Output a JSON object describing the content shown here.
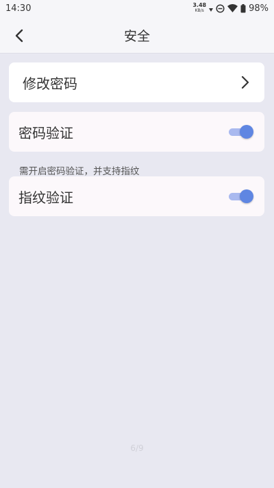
{
  "status_bar": {
    "time": "14:30",
    "net_speed_value": "3.48",
    "net_speed_unit": "KB/s",
    "battery": "98%",
    "icons": [
      "data-arrows-icon",
      "dnd-icon",
      "wifi-icon",
      "battery-icon"
    ]
  },
  "app_bar": {
    "title": "安全",
    "back_icon": "back-arrow-icon"
  },
  "items": {
    "change_password": {
      "label": "修改密码",
      "icon": "chevron-right-icon"
    },
    "password_verify": {
      "label": "密码验证",
      "enabled": true
    },
    "fingerprint_hint": "需开启密码验证，并支持指纹",
    "fingerprint_verify": {
      "label": "指纹验证",
      "enabled": true
    }
  },
  "page_indicator": "6/9",
  "colors": {
    "background": "#e8e8f1",
    "toggle_thumb": "#5f86e2",
    "toggle_track": "#a9b9ef"
  }
}
